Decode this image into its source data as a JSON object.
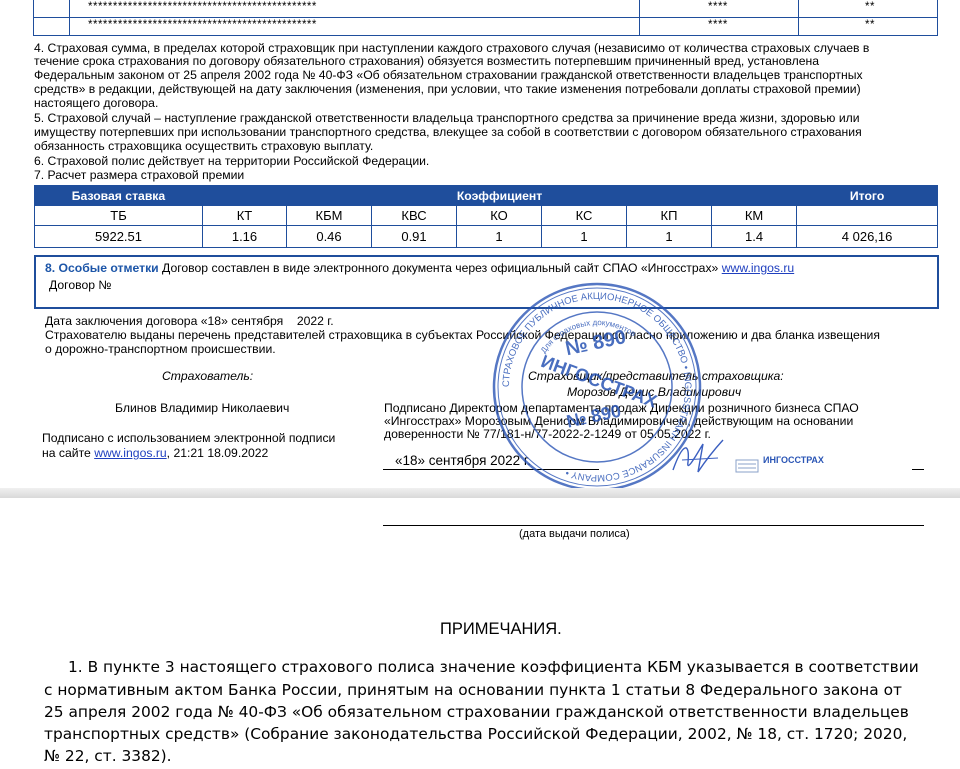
{
  "top_rows": [
    {
      "masked": "**********************************************",
      "col3": "****",
      "col4": "**"
    },
    {
      "masked": "**********************************************",
      "col3": "****",
      "col4": "**"
    }
  ],
  "paragraphs": {
    "p4": [
      "4. Страховая сумма, в пределах которой страховщик при наступлении каждого страхового случая (независимо от количества страховых случаев в",
      "течение срока страхования по договору обязательного страхования) обязуется возместить потерпевшим причиненный вред, установлена",
      "Федеральным законом от 25 апреля 2002 года № 40-ФЗ «Об обязательном страховании гражданской ответственности владельцев транспортных",
      "средств» в редакции, действующей на дату заключения (изменения, при условии, что такие изменения потребовали доплаты страховой премии)",
      "настоящего договора."
    ],
    "p5": [
      "5. Страховой случай – наступление гражданской ответственности владельца транспортного средства за причинение вреда жизни, здоровью или",
      "имуществу потерпевших при использовании транспортного средства, влекущее за собой в соответствии с договором обязательного страхования",
      "обязанность страховщика осуществить страховую выплату."
    ],
    "p6": "6. Страховой полис действует на территории Российской Федерации.",
    "p7": "7. Расчет размера страховой премии"
  },
  "premium_table": {
    "headers": {
      "base": "Базовая ставка",
      "coef": "Коэффициент",
      "total": "Итого"
    },
    "subheaders": [
      "ТБ",
      "КТ",
      "КБМ",
      "КВС",
      "КО",
      "КС",
      "КП",
      "КМ"
    ],
    "values": [
      "5922.51",
      "1.16",
      "0.46",
      "0.91",
      "1",
      "1",
      "1",
      "1.4"
    ],
    "total": "4 026,16"
  },
  "special_marks": {
    "title": "8. Особые отметки",
    "text": " Договор составлен в виде электронного документа через официальный сайт СПАО «Ингосстрах» ",
    "link": "www.ingos.ru",
    "contract": "Договор №"
  },
  "contract_date": {
    "label": "Дата заключения договора «18» сентября",
    "year": "2022 г."
  },
  "issued_text": [
    "Страхователю выданы перечень представителей страховщика в субъектах Российской Федерации согласно приложению и два бланка извещения",
    "о дорожно-транспортном происшествии."
  ],
  "insured": {
    "role": "Страхователь:",
    "name": "Блинов Владимир Николаевич",
    "signed_prefix": "Подписано с использованием электронной подписи",
    "signed_on": "на сайте ",
    "signed_link": "www.ingos.ru",
    "signed_time": ", 21:21 18.09.2022"
  },
  "insurer": {
    "role": "Страховщик/представитель страховщика:",
    "name": "Морозов Денис Владимирович",
    "signed": [
      "Подписано Директором департамента продаж Дирекции розничного бизнеса СПАО",
      "«Ингосстрах» Морозовым Денисом Владимировичем, действующим на основании",
      "доверенности № 77/181-н/77-2022-2-1249 от 05.05.2022 г."
    ],
    "date": "«18» сентября 2022 г.",
    "logo_text": "ИНГОССТРАХ"
  },
  "stamp": {
    "number": "№ 890",
    "name": "ИНГОССТРАХ",
    "ring_text": "СТРАХОВОЕ ПУБЛИЧНОЕ АКЦИОНЕРНОЕ ОБЩЕСТВО • INGOSSTRAKH INSURANCE COMPANY •",
    "inner_text": "Для страховых документов"
  },
  "issue_date_label": "(дата выдачи полиса)",
  "notes": {
    "title": "ПРИМЕЧАНИЯ.",
    "lines": [
      "1. В пункте 3 настоящего страхового полиса значение коэффициента КБМ указывается в соответствии",
      "с нормативным актом Банка России, принятым на основании пункта 1 статьи 8 Федерального закона от",
      "25 апреля 2002 года № 40-ФЗ «Об обязательном страховании гражданской ответственности владельцев",
      "транспортных средств» (Собрание законодательства Российской Федерации, 2002, № 18, ст. 1720; 2020,",
      "№ 22, ст. 3382)."
    ]
  },
  "colors": {
    "accent": "#1f4e9c",
    "stamp": "#2a55b5",
    "link": "#1f3fbf",
    "divider": "#d0d0d0"
  }
}
